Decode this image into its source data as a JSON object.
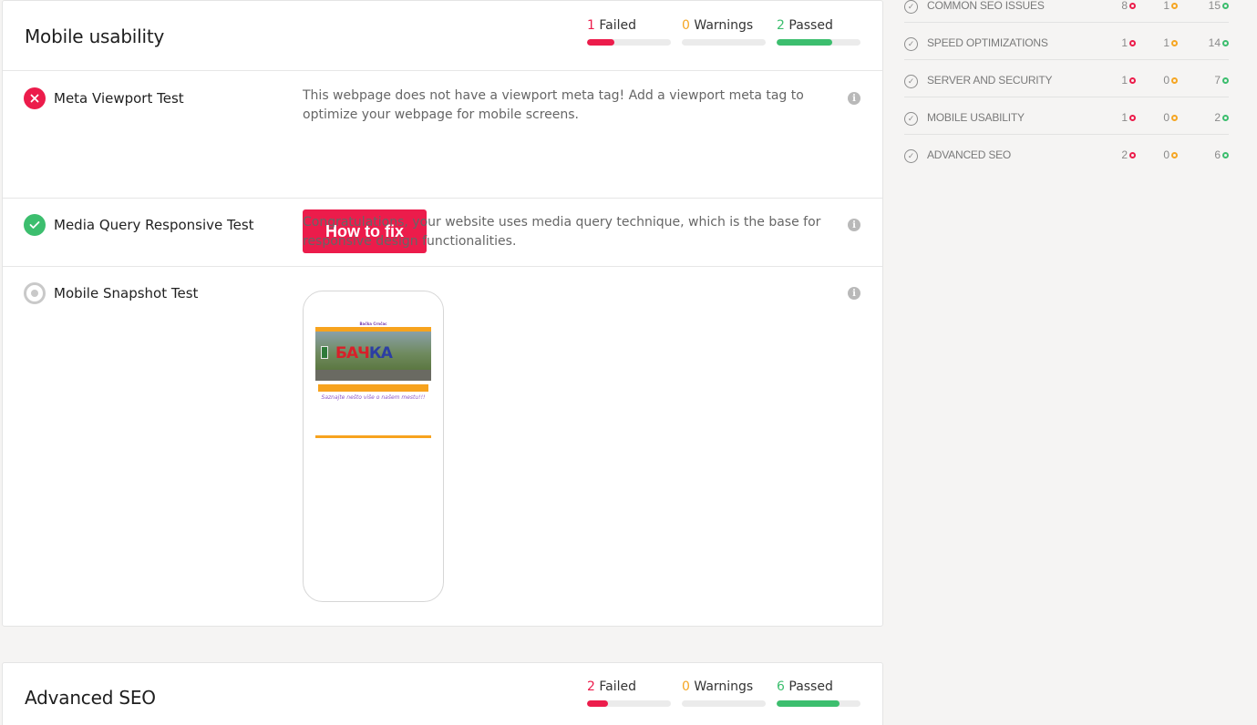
{
  "colors": {
    "failed": "#ec1c4b",
    "warning": "#f5a623",
    "passed": "#3cbe6e"
  },
  "mobile_usability": {
    "title": "Mobile usability",
    "stats": {
      "failed": {
        "count": "1",
        "label": "Failed",
        "fraction": 0.33
      },
      "warnings": {
        "count": "0",
        "label": "Warnings",
        "fraction": 0
      },
      "passed": {
        "count": "2",
        "label": "Passed",
        "fraction": 0.66
      }
    },
    "tests": [
      {
        "status": "failed",
        "title": "Meta Viewport Test",
        "description": "This webpage does not have a viewport meta tag! Add a viewport meta tag to optimize your webpage for mobile screens.",
        "button": "How to fix"
      },
      {
        "status": "passed",
        "title": "Media Query Responsive Test",
        "description": "Congratulations, your website uses media query technique, which is the base for responsive design functionalities."
      },
      {
        "status": "neutral",
        "title": "Mobile Snapshot Test",
        "snapshot": {
          "site_title": "Bačka Crnčac",
          "hero_text": "БАЧКА",
          "subtitle": "Saznajte nešto više o našem mestu!!!"
        }
      }
    ]
  },
  "advanced_seo": {
    "title": "Advanced SEO",
    "stats": {
      "failed": {
        "count": "2",
        "label": "Failed",
        "fraction": 0.25
      },
      "warnings": {
        "count": "0",
        "label": "Warnings",
        "fraction": 0
      },
      "passed": {
        "count": "6",
        "label": "Passed",
        "fraction": 0.75
      }
    }
  },
  "sidebar": {
    "items": [
      {
        "label": "COMMON SEO ISSUES",
        "failed": "8",
        "warnings": "1",
        "passed": "15"
      },
      {
        "label": "SPEED OPTIMIZATIONS",
        "failed": "1",
        "warnings": "1",
        "passed": "14"
      },
      {
        "label": "SERVER AND SECURITY",
        "failed": "1",
        "warnings": "0",
        "passed": "7"
      },
      {
        "label": "MOBILE USABILITY",
        "failed": "1",
        "warnings": "0",
        "passed": "2"
      },
      {
        "label": "ADVANCED SEO",
        "failed": "2",
        "warnings": "0",
        "passed": "6"
      }
    ]
  }
}
